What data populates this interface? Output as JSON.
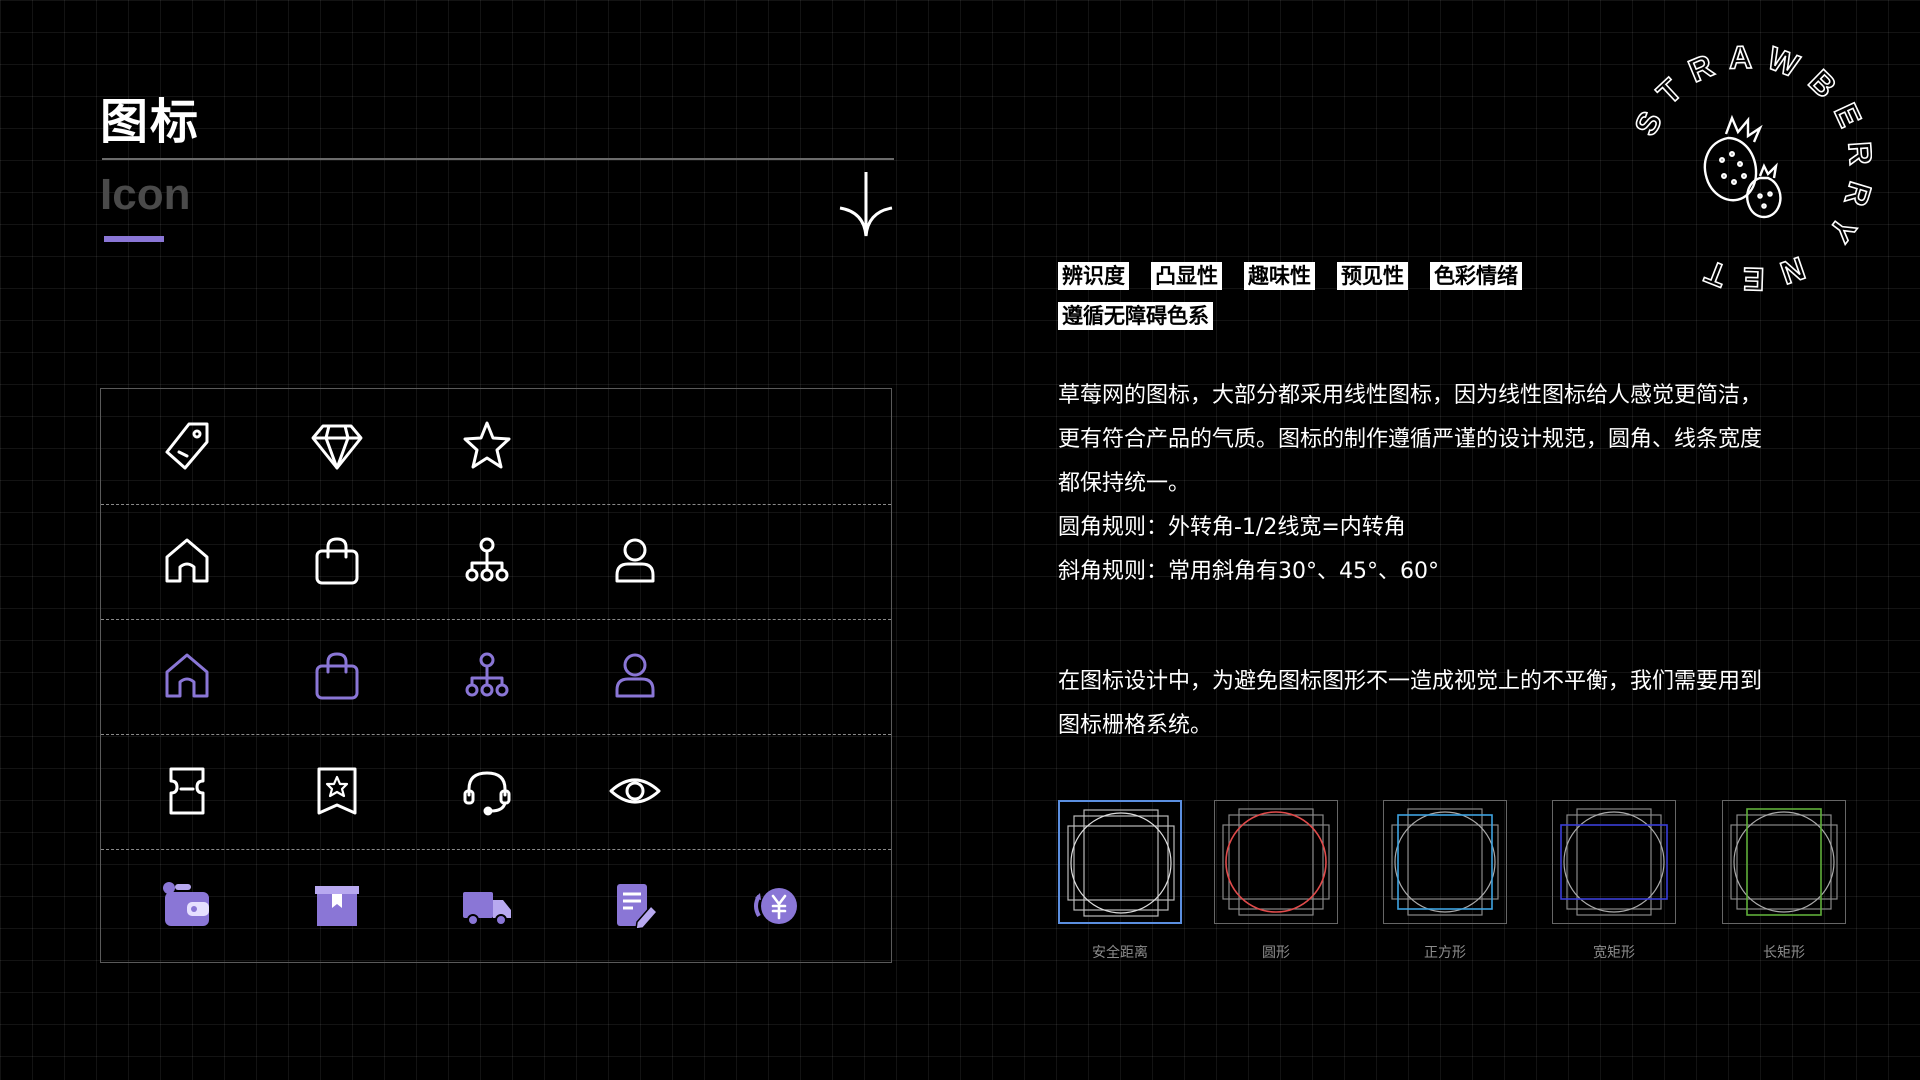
{
  "header": {
    "title_cn": "图标",
    "title_en": "Icon"
  },
  "logo": {
    "text": "STRAWBERRY NET"
  },
  "tags": {
    "row1": [
      "辨识度",
      "凸显性",
      "趣味性",
      "预见性",
      "色彩情绪"
    ],
    "row2": [
      "遵循无障碍色系"
    ]
  },
  "description": {
    "para1": [
      "草莓网的图标，大部分都采用线性图标，因为线性图标给人感觉更简洁，",
      "更有符合产品的气质。图标的制作遵循严谨的设计规范，圆角、线条宽度",
      "都保持统一。",
      "圆角规则：外转角-1/2线宽=内转角",
      "斜角规则：常用斜角有30°、45°、60°"
    ],
    "para2": [
      "在图标设计中，为避免图标图形不一造成视觉上的不平衡，我们需要用到",
      "图标栅格系统。"
    ]
  },
  "grid_system": {
    "items": [
      {
        "label": "安全距离",
        "accent": "#5b8fe0"
      },
      {
        "label": "圆形",
        "accent": "#e04b4b"
      },
      {
        "label": "正方形",
        "accent": "#3fa3e0"
      },
      {
        "label": "宽矩形",
        "accent": "#3b3fd6"
      },
      {
        "label": "长矩形",
        "accent": "#5fae3a"
      }
    ]
  },
  "icon_panel": {
    "rows": [
      {
        "style": "line-white",
        "icons": [
          "tag-icon",
          "diamond-icon",
          "star-icon"
        ]
      },
      {
        "style": "line-white",
        "icons": [
          "home-icon",
          "shopping-bag-icon",
          "org-chart-icon",
          "user-icon"
        ]
      },
      {
        "style": "line-purple",
        "icons": [
          "home-icon",
          "shopping-bag-icon",
          "org-chart-icon",
          "user-icon"
        ]
      },
      {
        "style": "line-white",
        "icons": [
          "coupon-icon",
          "favorite-badge-icon",
          "headset-icon",
          "eye-icon"
        ]
      },
      {
        "style": "filled-purple",
        "icons": [
          "wallet-icon",
          "box-icon",
          "truck-icon",
          "note-edit-icon",
          "refund-icon"
        ]
      }
    ]
  },
  "colors": {
    "accent_purple": "#8a76d6",
    "white": "#ffffff",
    "muted_text": "#4a4a4a"
  }
}
